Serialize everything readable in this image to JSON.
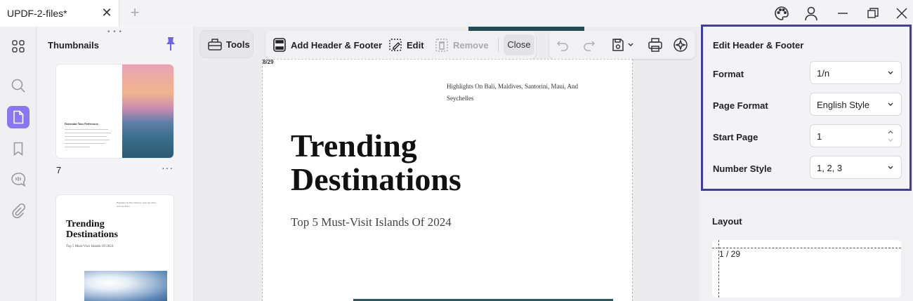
{
  "titlebar": {
    "tab_title": "UPDF-2-files*",
    "close_glyph": "✕",
    "new_tab_glyph": "+",
    "icons": [
      "palette-icon",
      "user-icon",
      "minimize-icon",
      "restore-icon",
      "window-close-icon"
    ]
  },
  "rail": {
    "items": [
      "grid-icon",
      "search-icon",
      "pages-icon",
      "bookmark-icon",
      "comment-icon",
      "attachment-icon"
    ],
    "active": "pages-icon",
    "accent": "#8a76f3"
  },
  "thumbnails": {
    "title": "Thumbnails",
    "grip": "• • •",
    "pages": [
      {
        "number": "7",
        "more": "···",
        "heading": "Determine Your Preferences"
      },
      {
        "header": "Highlights On Bali, Maldives, Santorini, Maui, And Seychelles",
        "title_line1": "Trending",
        "title_line2": "Destinations",
        "subtitle": "Top 5 Must-Visit Islands Of 2024"
      }
    ]
  },
  "toolbar": {
    "tools_label": "Tools",
    "add_label": "Add Header & Footer",
    "edit_label": "Edit",
    "remove_label": "Remove",
    "close_label": "Close"
  },
  "document": {
    "page_marker": "8/29",
    "header": "Highlights On Bali, Maldives, Santorini, Maui, And Seychelles",
    "title_line1": "Trending",
    "title_line2": "Destinations",
    "subtitle": "Top 5 Must-Visit Islands Of 2024"
  },
  "panel": {
    "title": "Edit Header & Footer",
    "border_color": "#3e3eaa",
    "fields": [
      {
        "label": "Format",
        "value": "1/n"
      },
      {
        "label": "Page Format",
        "value": "English Style"
      },
      {
        "label": "Start Page",
        "value": "1"
      },
      {
        "label": "Number Style",
        "value": "1, 2, 3"
      }
    ],
    "layout_title": "Layout",
    "layout_preview": "1 / 29"
  }
}
